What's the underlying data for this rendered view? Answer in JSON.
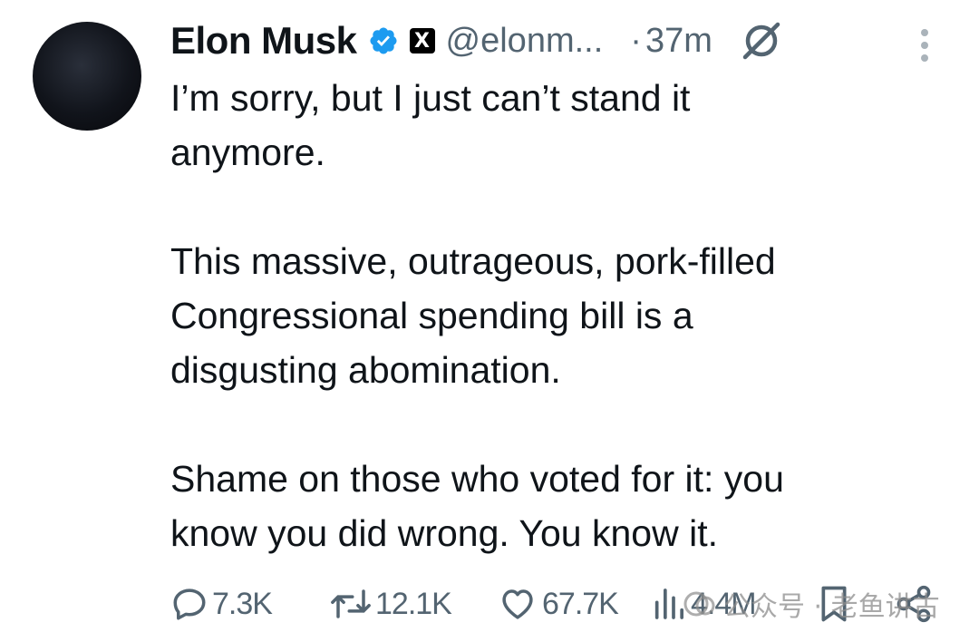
{
  "tweet": {
    "author": {
      "name": "Elon Musk",
      "handle": "@elonm...",
      "verified": true,
      "affiliate_badge": "X"
    },
    "separator": "·",
    "time": "37m",
    "text": "I’m sorry, but I just can’t stand it\nanymore.\n\nThis massive, outrageous, pork-filled\nCongressional spending bill is a\ndisgusting abomination.\n\nShame on those who voted for it: you\nknow you did wrong. You know it.",
    "stats": {
      "replies": "7.3K",
      "reposts": "12.1K",
      "likes": "67.7K",
      "views": "4.4M"
    },
    "icons": {
      "verified": "verified-badge-icon",
      "grok": "grok-icon",
      "more": "more-options-icon",
      "reply": "reply-icon",
      "repost": "repost-icon",
      "like": "heart-icon",
      "views": "views-icon",
      "bookmark": "bookmark-icon",
      "share": "share-icon"
    },
    "colors": {
      "text": "#0f1419",
      "secondary": "#536471",
      "verified": "#1d9bf0"
    }
  },
  "watermark": {
    "text": "公众号 · 老鱼讲古"
  }
}
